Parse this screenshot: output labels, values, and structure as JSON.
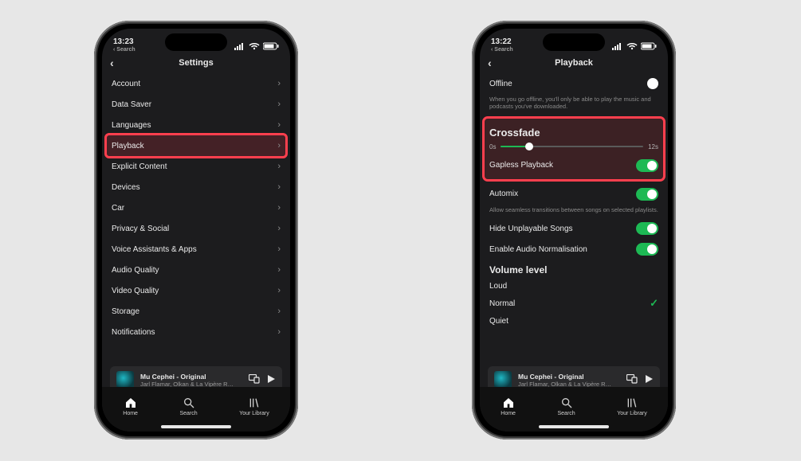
{
  "status": {
    "time_left": "13:23",
    "time_right": "13:22",
    "back_hint": "Search"
  },
  "left": {
    "title": "Settings",
    "rows": [
      {
        "label": "Account"
      },
      {
        "label": "Data Saver"
      },
      {
        "label": "Languages"
      },
      {
        "label": "Playback",
        "highlight": true
      },
      {
        "label": "Explicit Content"
      },
      {
        "label": "Devices"
      },
      {
        "label": "Car"
      },
      {
        "label": "Privacy & Social"
      },
      {
        "label": "Voice Assistants & Apps"
      },
      {
        "label": "Audio Quality"
      },
      {
        "label": "Video Quality"
      },
      {
        "label": "Storage"
      },
      {
        "label": "Notifications"
      }
    ]
  },
  "right": {
    "title": "Playback",
    "offline": {
      "label": "Offline",
      "enabled": false,
      "desc": "When you go offline, you'll only be able to play the music and podcasts you've downloaded."
    },
    "crossfade": {
      "title": "Crossfade",
      "min_label": "0s",
      "max_label": "12s",
      "value_pct": 20
    },
    "gapless": {
      "label": "Gapless Playback",
      "enabled": true
    },
    "automix": {
      "label": "Automix",
      "enabled": true,
      "desc": "Allow seamless transitions between songs on selected playlists."
    },
    "hide_unplayable": {
      "label": "Hide Unplayable Songs",
      "enabled": true
    },
    "normalisation": {
      "label": "Enable Audio Normalisation",
      "enabled": true
    },
    "volume": {
      "title": "Volume level",
      "options": [
        "Loud",
        "Normal",
        "Quiet"
      ],
      "selected": "Normal"
    }
  },
  "nowplaying": {
    "title": "Mu Cephei - Original",
    "subtitle": "Jarl Flamar, Olkan & La Vipère R…"
  },
  "tabs": {
    "home": "Home",
    "search": "Search",
    "library": "Your Library"
  }
}
